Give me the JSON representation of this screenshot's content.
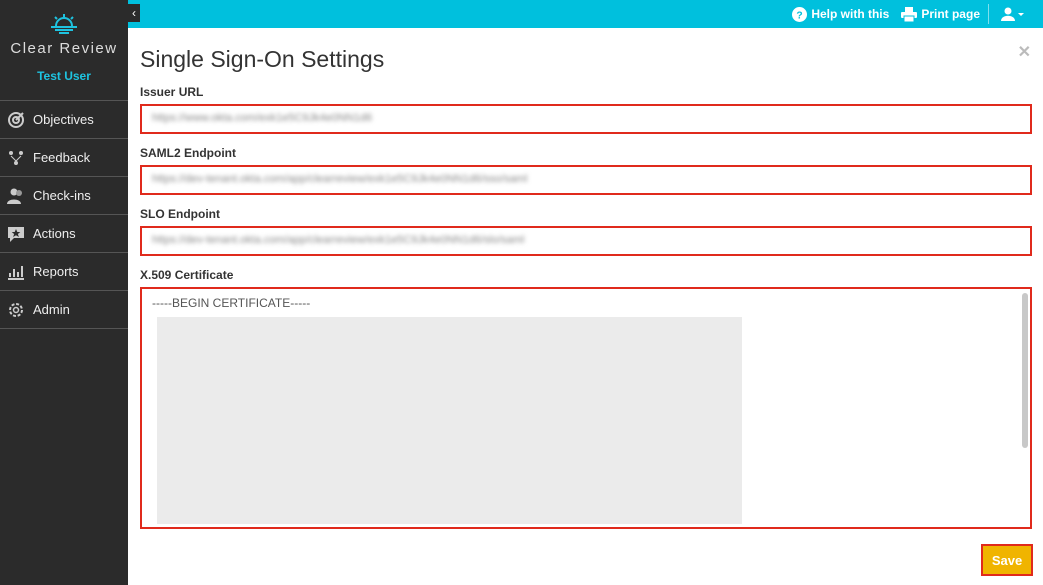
{
  "app": {
    "brand": "Clear Review",
    "user": "Test User"
  },
  "sidebar": {
    "items": [
      {
        "label": "Objectives",
        "icon": "target-icon"
      },
      {
        "label": "Feedback",
        "icon": "feedback-icon"
      },
      {
        "label": "Check-ins",
        "icon": "users-icon"
      },
      {
        "label": "Actions",
        "icon": "star-chat-icon"
      },
      {
        "label": "Reports",
        "icon": "bar-chart-icon"
      },
      {
        "label": "Admin",
        "icon": "gear-icon"
      }
    ]
  },
  "topbar": {
    "help": "Help with this",
    "print": "Print page"
  },
  "page": {
    "title": "Single Sign-On Settings",
    "save": "Save"
  },
  "form": {
    "issuer_label": "Issuer URL",
    "issuer_value": "https://www.okta.com/exk1e5C9Jk4e0NN1d6",
    "saml_label": "SAML2 Endpoint",
    "saml_value": "https://dev-tenant.okta.com/app/clearreview/exk1e5C9Jk4e0NN1d6/sso/saml",
    "slo_label": "SLO Endpoint",
    "slo_value": "https://dev-tenant.okta.com/app/clearreview/exk1e5C9Jk4e0NN1d6/slo/saml",
    "cert_label": "X.509 Certificate",
    "cert_first_line": "-----BEGIN CERTIFICATE-----"
  },
  "colors": {
    "accent": "#00c0dd",
    "sidebar": "#2b2b2b",
    "highlight": "#e02a1c",
    "save": "#f0b400"
  }
}
